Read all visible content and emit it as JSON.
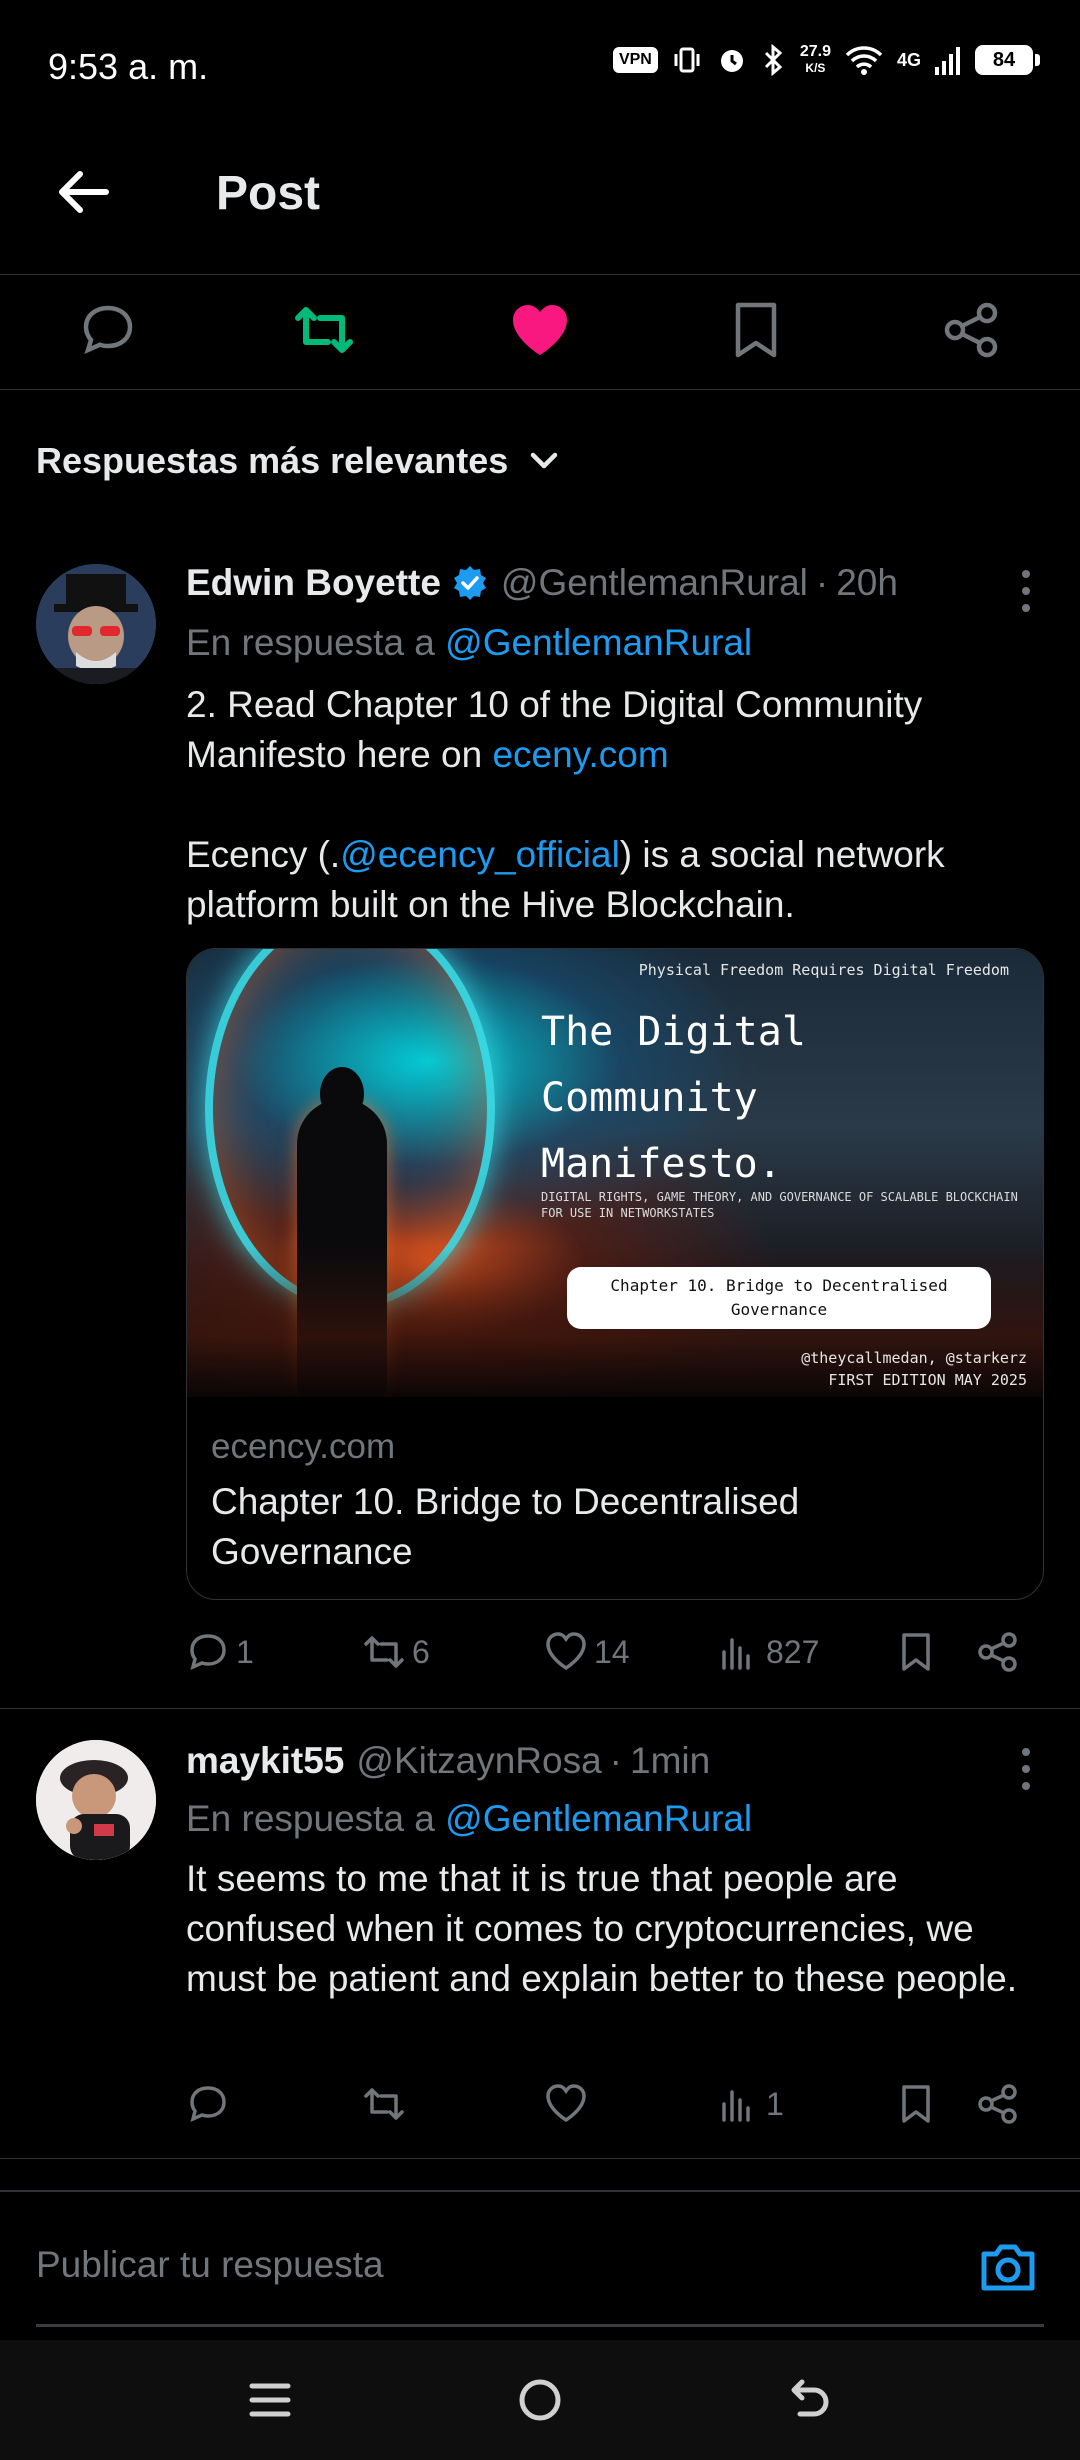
{
  "status_bar": {
    "time": "9:53 a. m.",
    "vpn": "VPN",
    "speed_value": "27.9",
    "speed_unit": "K/S",
    "network": "4G",
    "battery": "84"
  },
  "header": {
    "title": "Post"
  },
  "post_actions": {
    "reply_icon": "comment-icon",
    "retweet_icon": "retweet-icon",
    "retweet_color": "#00ba7c",
    "like_icon": "heart-filled-icon",
    "like_color": "#f91880",
    "bookmark_icon": "bookmark-icon",
    "share_icon": "share-icon"
  },
  "sort": {
    "label": "Respuestas más relevantes"
  },
  "tweets": [
    {
      "name": "Edwin Boyette",
      "verified": true,
      "handle": "@GentlemanRural",
      "sep": "·",
      "time": "20h",
      "reply_prefix": "En respuesta a ",
      "reply_handle": "@GentlemanRural",
      "body_1a": "2.  Read Chapter 10 of the Digital Community Manifesto here on ",
      "body_1_link": "eceny.com",
      "body_2a": "Ecency (.",
      "body_2_link": "@ecency_official",
      "body_2b": ")  is a social network platform built on the Hive Blockchain.",
      "card": {
        "image_top": "Physical Freedom Requires Digital Freedom",
        "image_title_1": "The Digital",
        "image_title_2": "Community",
        "image_title_3": "Manifesto.",
        "image_subtitle": "DIGITAL RIGHTS, GAME THEORY, AND GOVERNANCE OF SCALABLE BLOCKCHAIN FOR USE IN NETWORKSTATES",
        "image_pill": "Chapter 10. Bridge to Decentralised Governance",
        "image_authors": "@theycallmedan, @starkerz",
        "image_edition": "FIRST EDITION MAY 2025",
        "domain": "ecency.com",
        "title": "Chapter 10. Bridge to Decentralised Governance"
      },
      "stats": {
        "replies": "1",
        "retweets": "6",
        "likes": "14",
        "views": "827"
      }
    },
    {
      "name": "maykit55",
      "verified": false,
      "handle": "@KitzaynRosa",
      "sep": "·",
      "time": "1min",
      "reply_prefix": "En respuesta a ",
      "reply_handle": "@GentlemanRural",
      "body": "It seems to me that it is true that people are confused when it comes to cryptocurrencies, we must be patient and explain better to these people.",
      "stats": {
        "replies": "",
        "retweets": "",
        "likes": "",
        "views": "1"
      }
    }
  ],
  "reply_bar": {
    "placeholder": "Publicar tu respuesta",
    "camera_icon": "camera-icon"
  },
  "navbar": {
    "menu_icon": "menu-icon",
    "home_icon": "home-circle-icon",
    "back_icon": "back-icon"
  },
  "colors": {
    "accent": "#1d9bf0",
    "muted": "#71767b",
    "text": "#e7e9ea",
    "border": "#2f3336"
  }
}
